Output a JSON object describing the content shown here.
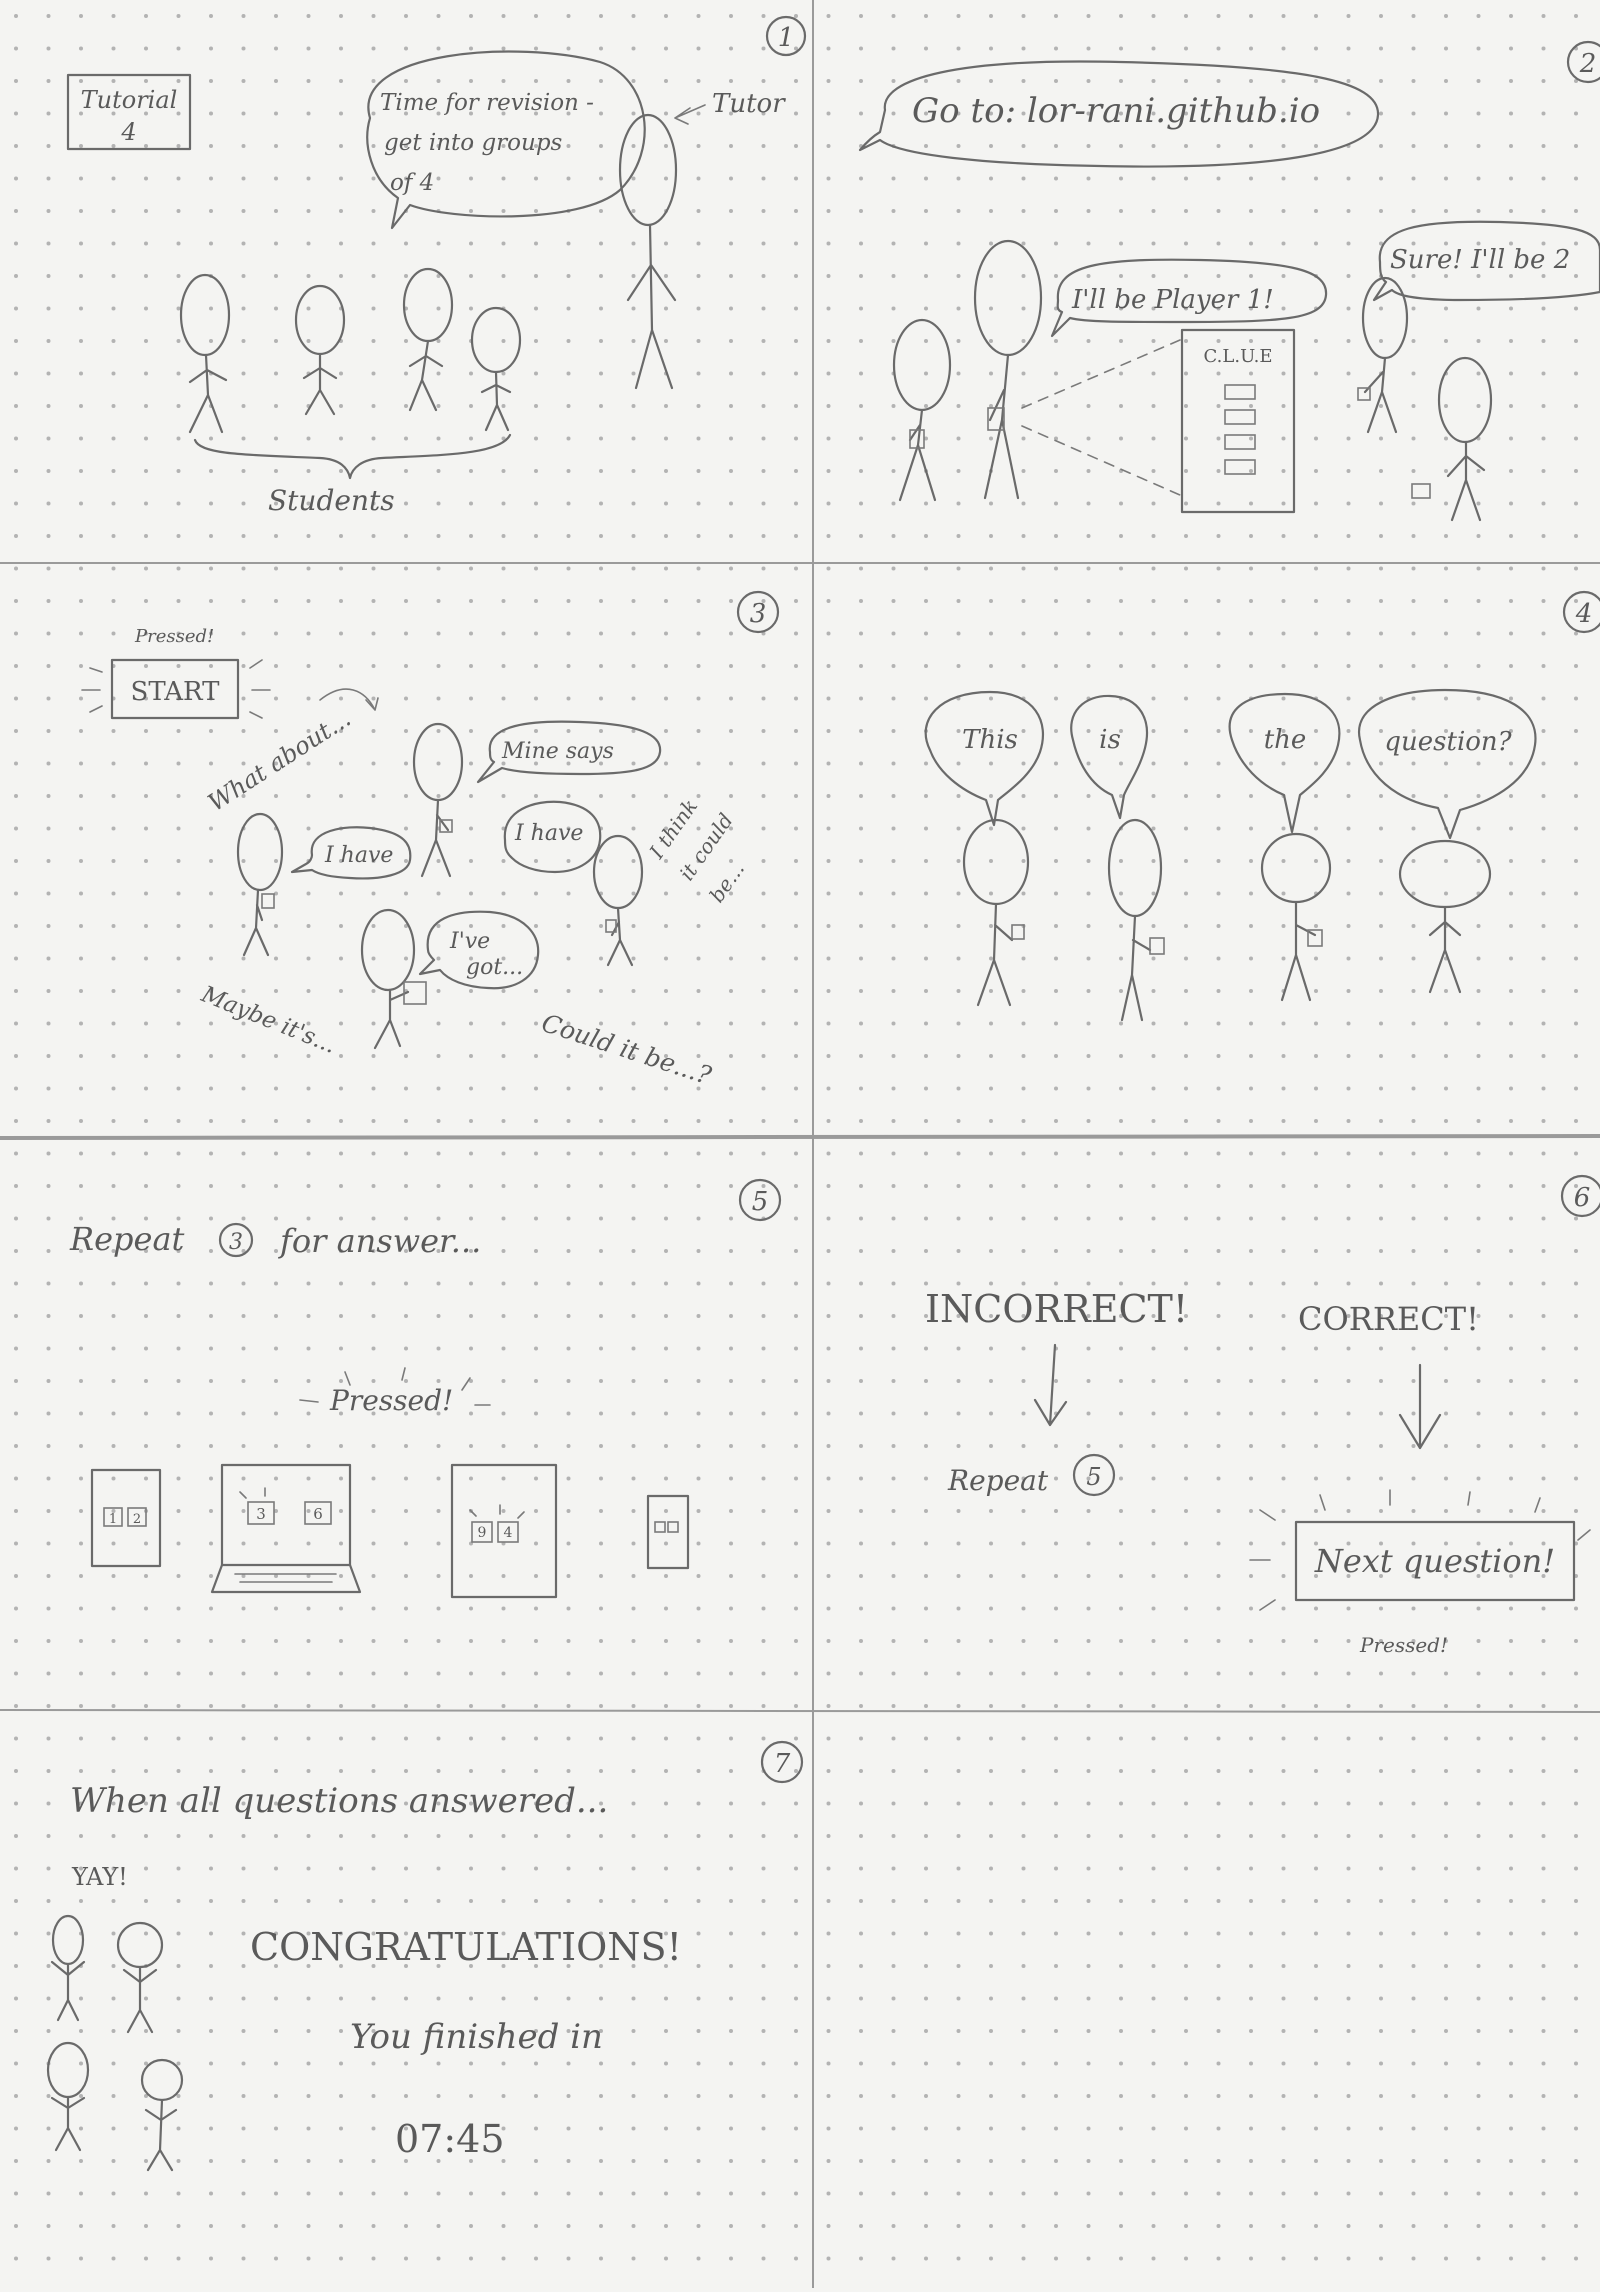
{
  "panels": {
    "p1": {
      "number": "1",
      "tutorial_label": "Tutorial",
      "tutorial_number": "4",
      "speech_lines": [
        "Time for revision -",
        "get into groups",
        "of 4"
      ],
      "tutor_label": "Tutor",
      "students_label": "Students"
    },
    "p2": {
      "number": "2",
      "url_text": "Go to: lor-rani.github.io",
      "player1_text": "I'll be Player 1!",
      "player2_text": "Sure! I'll be 2",
      "screen_label": "C.L.U.E"
    },
    "p3": {
      "number": "3",
      "pressed_text": "Pressed!",
      "start_label": "START",
      "what_about": "What about...",
      "mine_says": "Mine says",
      "i_have_1": "I have",
      "i_have_2": "I have",
      "i_think": [
        "I think",
        "it could",
        "be..."
      ],
      "ive_got": [
        "I've",
        "got..."
      ],
      "maybe_its": "Maybe it's...",
      "could_it_be": "Could it be...?"
    },
    "p4": {
      "number": "4",
      "words": [
        "This",
        "is",
        "the",
        "question?"
      ]
    },
    "p5": {
      "number": "5",
      "repeat_prefix": "Repeat",
      "repeat_ref": "3",
      "repeat_suffix": "for answer...",
      "pressed_text": "Pressed!",
      "tile_numbers": [
        "1",
        "2",
        "3",
        "6",
        "9",
        "4"
      ]
    },
    "p6": {
      "number": "6",
      "incorrect": "INCORRECT!",
      "correct": "CORRECT!",
      "repeat_prefix": "Repeat",
      "repeat_ref": "5",
      "next_question": "Next question!",
      "pressed_text": "Pressed!"
    },
    "p7": {
      "number": "7",
      "when_text": "When all questions answered...",
      "yay": "YAY!",
      "congrats": "CONGRATULATIONS!",
      "finished": "You finished in",
      "time": "07:45"
    }
  },
  "colors": {
    "paper": "#f4f4f2",
    "ink": "#6a6a6a",
    "dot": "#b3b3b3"
  }
}
